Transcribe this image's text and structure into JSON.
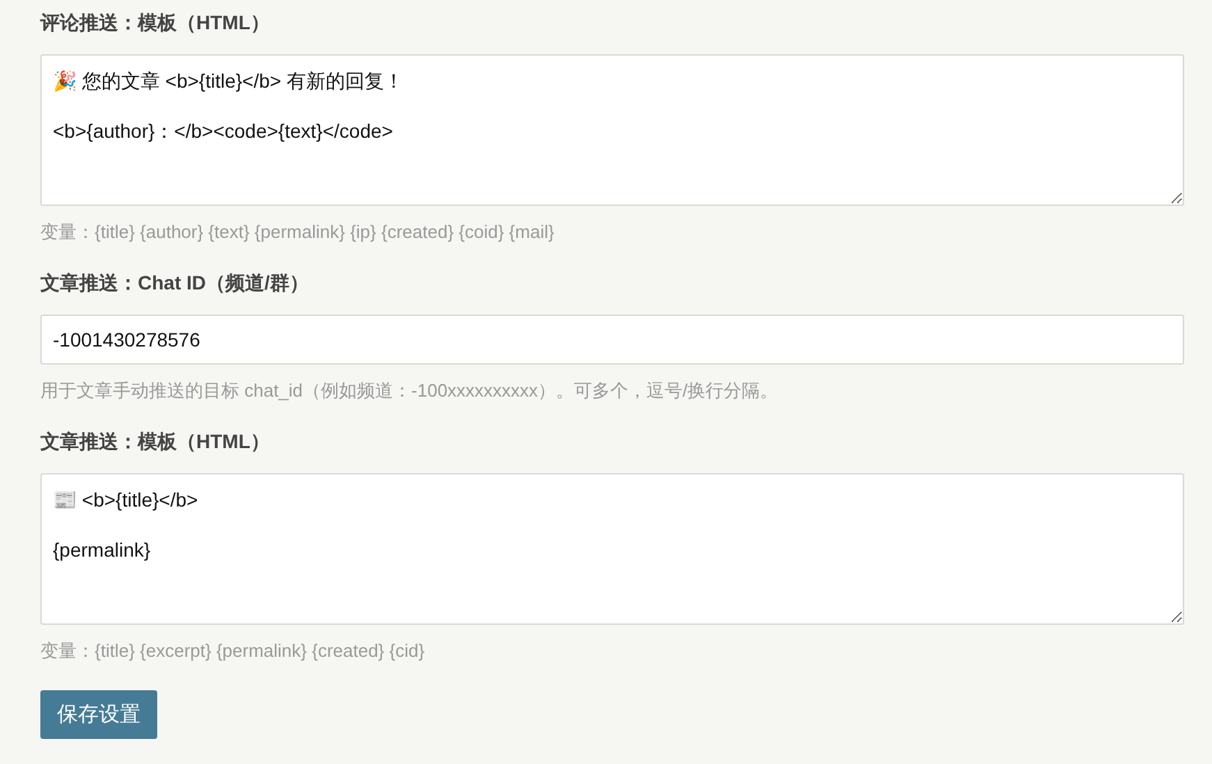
{
  "fields": [
    {
      "kind": "textarea",
      "label": "评论推送：模板（HTML）",
      "value": "🎉 您的文章 <b>{title}</b> 有新的回复！\n\n<b>{author}：</b><code>{text}</code>",
      "hint": "变量：{title} {author} {text} {permalink} {ip} {created} {coid} {mail}"
    },
    {
      "kind": "input",
      "label": "文章推送：Chat ID（频道/群）",
      "value": "-1001430278576",
      "hint": "用于文章手动推送的目标 chat_id（例如频道：-100xxxxxxxxxx）。可多个，逗号/换行分隔。"
    },
    {
      "kind": "textarea",
      "label": "文章推送：模板（HTML）",
      "value": "📰 <b>{title}</b>\n\n{permalink}",
      "hint": "变量：{title} {excerpt} {permalink} {created} {cid}"
    }
  ],
  "save_button": "保存设置"
}
